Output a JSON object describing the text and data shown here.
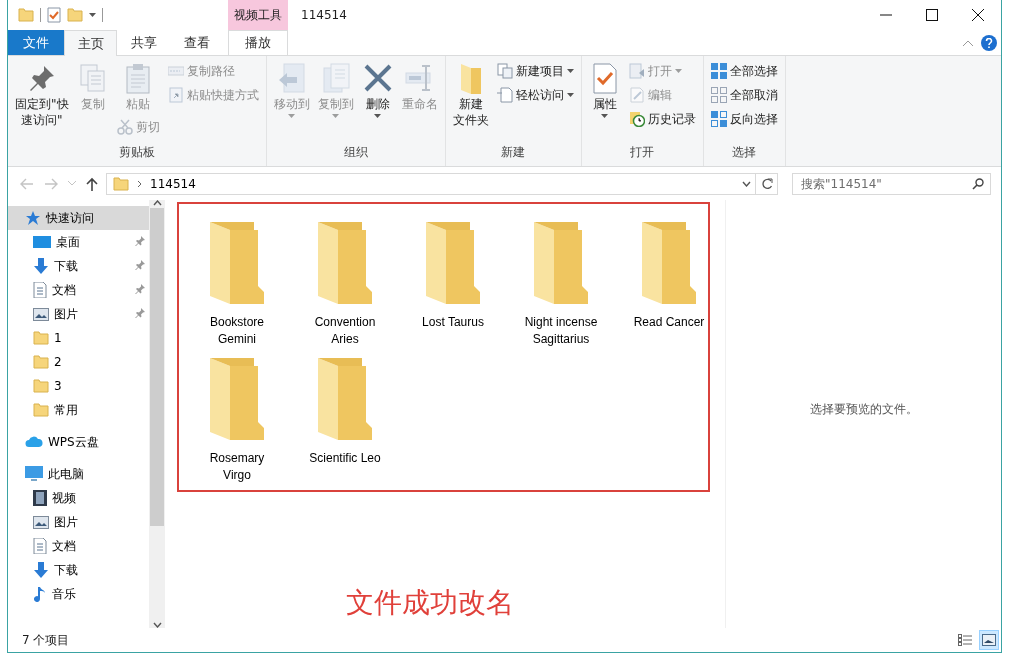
{
  "window": {
    "title": "114514"
  },
  "contextual_tab_group": {
    "label": "视频工具"
  },
  "tabs": [
    {
      "label": "文件",
      "kind": "file",
      "selected": false
    },
    {
      "label": "主页",
      "kind": "normal",
      "selected": true
    },
    {
      "label": "共享",
      "kind": "normal",
      "selected": false
    },
    {
      "label": "查看",
      "kind": "normal",
      "selected": false
    },
    {
      "label": "播放",
      "kind": "contextual",
      "selected": false
    }
  ],
  "ribbon": {
    "groups": [
      {
        "label": "剪贴板",
        "columns": [
          [
            {
              "kind": "large",
              "lines": [
                "固定到\"快",
                "速访问\""
              ],
              "disabled": false,
              "dropdown": false
            }
          ],
          [
            {
              "kind": "large",
              "lines": [
                "复制"
              ],
              "disabled": true,
              "dropdown": false
            }
          ],
          [
            {
              "kind": "large",
              "lines": [
                "粘贴"
              ],
              "disabled": true,
              "dropdown": false
            },
            {
              "kind": "small",
              "label": "剪切",
              "disabled": true,
              "dropdown": false
            }
          ],
          [
            {
              "kind": "small",
              "label": "复制路径",
              "disabled": true,
              "dropdown": false
            },
            {
              "kind": "small",
              "label": "粘贴快捷方式",
              "disabled": true,
              "dropdown": false
            }
          ]
        ]
      },
      {
        "label": "组织",
        "columns": [
          [
            {
              "kind": "large",
              "lines": [
                "移动到"
              ],
              "disabled": true,
              "dropdown": true
            }
          ],
          [
            {
              "kind": "large",
              "lines": [
                "复制到"
              ],
              "disabled": true,
              "dropdown": true
            }
          ],
          [
            {
              "kind": "large",
              "lines": [
                "删除"
              ],
              "disabled": false,
              "dropdown": true
            }
          ],
          [
            {
              "kind": "large",
              "lines": [
                "重命名"
              ],
              "disabled": true,
              "dropdown": false
            }
          ]
        ]
      },
      {
        "label": "新建",
        "columns": [
          [
            {
              "kind": "large",
              "lines": [
                "新建",
                "文件夹"
              ],
              "disabled": false,
              "dropdown": false
            }
          ],
          [
            {
              "kind": "small",
              "label": "新建项目",
              "disabled": false,
              "dropdown": true
            },
            {
              "kind": "small",
              "label": "轻松访问",
              "disabled": false,
              "dropdown": true
            }
          ]
        ]
      },
      {
        "label": "打开",
        "columns": [
          [
            {
              "kind": "large",
              "lines": [
                "属性"
              ],
              "disabled": false,
              "dropdown": true
            }
          ],
          [
            {
              "kind": "small",
              "label": "打开",
              "disabled": true,
              "dropdown": true
            },
            {
              "kind": "small",
              "label": "编辑",
              "disabled": true,
              "dropdown": false
            },
            {
              "kind": "small",
              "label": "历史记录",
              "disabled": false,
              "dropdown": false
            }
          ]
        ]
      },
      {
        "label": "选择",
        "columns": [
          [
            {
              "kind": "small",
              "label": "全部选择",
              "disabled": false,
              "dropdown": false
            },
            {
              "kind": "small",
              "label": "全部取消",
              "disabled": false,
              "dropdown": false
            },
            {
              "kind": "small",
              "label": "反向选择",
              "disabled": false,
              "dropdown": false
            }
          ]
        ]
      }
    ]
  },
  "address_bar": {
    "path": [
      "114514"
    ]
  },
  "search": {
    "placeholder": "搜索\"114514\""
  },
  "navigation": {
    "items": [
      {
        "label": "快速访问",
        "selected": true,
        "children": [
          {
            "label": "桌面",
            "selected": false,
            "pinned": true
          },
          {
            "label": "下载",
            "selected": false,
            "pinned": true
          },
          {
            "label": "文档",
            "selected": false,
            "pinned": true
          },
          {
            "label": "图片",
            "selected": false,
            "pinned": true
          },
          {
            "label": "1",
            "selected": false,
            "pinned": false
          },
          {
            "label": "2",
            "selected": false,
            "pinned": false
          },
          {
            "label": "3",
            "selected": false,
            "pinned": false
          },
          {
            "label": "常用",
            "selected": false,
            "pinned": false
          }
        ]
      },
      {
        "label": "WPS云盘",
        "selected": false
      },
      {
        "label": "此电脑",
        "selected": false,
        "children": [
          {
            "label": "视频",
            "selected": false
          },
          {
            "label": "图片",
            "selected": false
          },
          {
            "label": "文档",
            "selected": false
          },
          {
            "label": "下载",
            "selected": false
          },
          {
            "label": "音乐",
            "selected": false
          }
        ]
      }
    ]
  },
  "folders": [
    {
      "name": "Bookstore Gemini"
    },
    {
      "name": "Convention Aries"
    },
    {
      "name": "Lost Taurus"
    },
    {
      "name": "Night incense Sagittarius"
    },
    {
      "name": "Read Cancer"
    },
    {
      "name": "Rosemary Virgo"
    },
    {
      "name": "Scientific Leo"
    }
  ],
  "annotation": {
    "label": "文件成功改名"
  },
  "preview_pane": {
    "message": "选择要预览的文件。"
  },
  "status_bar": {
    "item_count": "7 个项目",
    "views": [
      {
        "selected": false
      },
      {
        "selected": true
      }
    ]
  }
}
